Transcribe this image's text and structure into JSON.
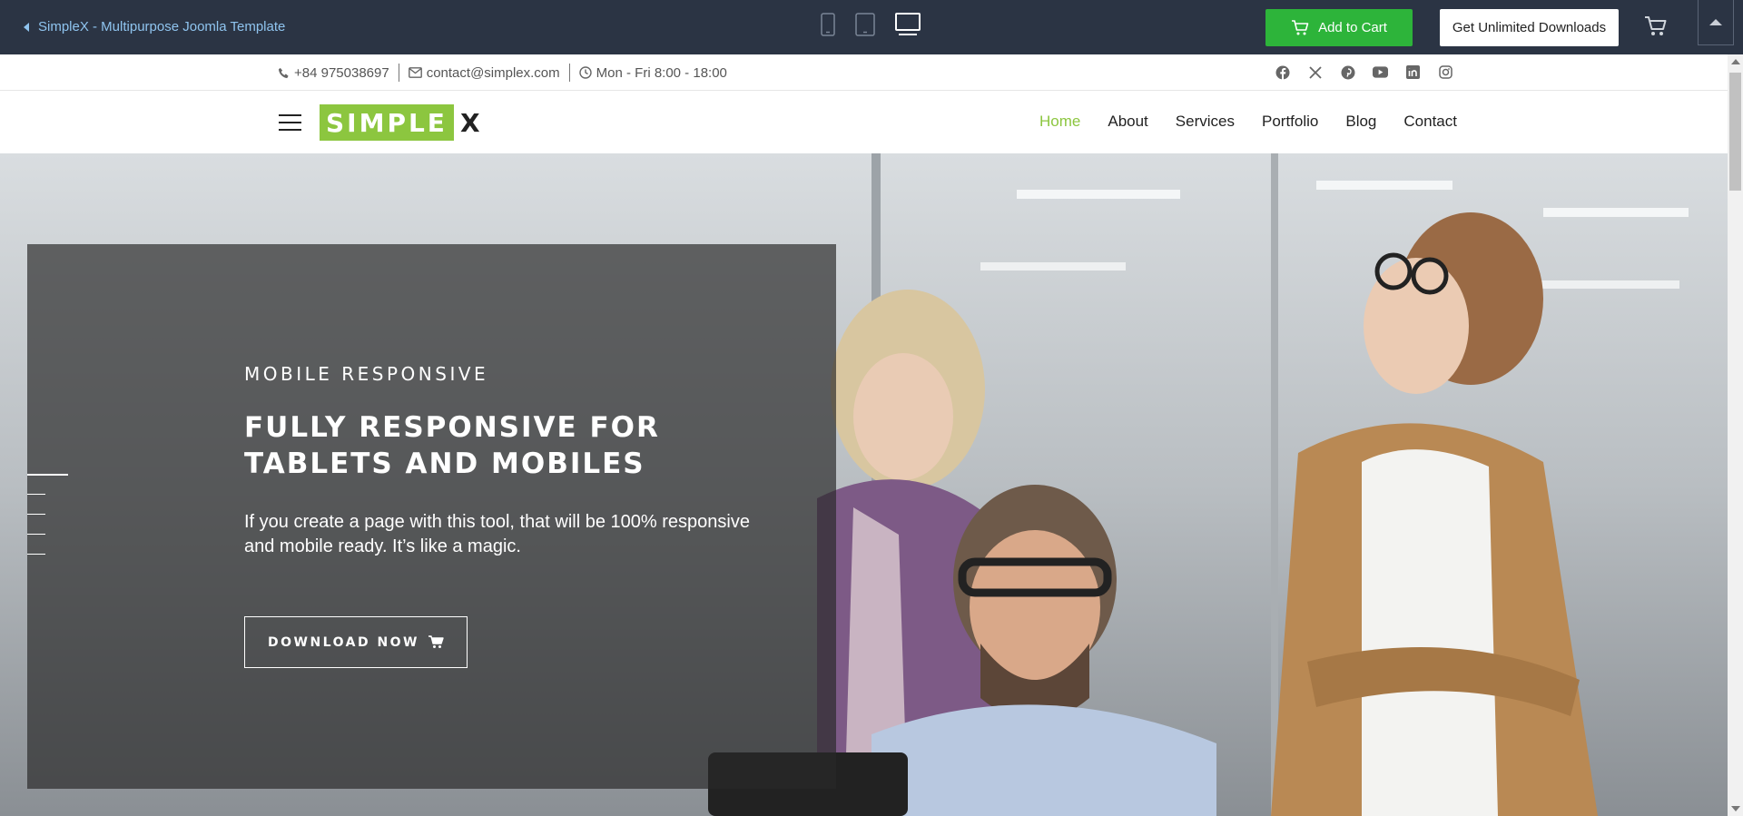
{
  "preview_bar": {
    "back_label": "SimpleX - Multipurpose Joomla Template",
    "devices": [
      "mobile-icon",
      "tablet-icon",
      "desktop-icon"
    ],
    "active_device": "desktop",
    "add_to_cart_label": "Add to Cart",
    "unlimited_label": "Get Unlimited Downloads",
    "colors": {
      "background": "#2b3444",
      "cart_button": "#2db43a",
      "link": "#8fc4ef"
    }
  },
  "info_bar": {
    "phone": "+84 975038697",
    "email": "contact@simplex.com",
    "hours": "Mon - Fri 8:00 - 18:00",
    "socials": [
      "facebook-icon",
      "x-twitter-icon",
      "pinterest-icon",
      "youtube-icon",
      "linkedin-icon",
      "instagram-icon"
    ]
  },
  "header": {
    "logo_box": "SIMPLE",
    "logo_x": "X",
    "nav": [
      {
        "label": "Home",
        "active": true
      },
      {
        "label": "About",
        "active": false
      },
      {
        "label": "Services",
        "active": false
      },
      {
        "label": "Portfolio",
        "active": false
      },
      {
        "label": "Blog",
        "active": false
      },
      {
        "label": "Contact",
        "active": false
      }
    ],
    "accent": "#8cc63f"
  },
  "hero": {
    "eyebrow": "MOBILE RESPONSIVE",
    "title": "FULLY RESPONSIVE FOR TABLETS AND MOBILES",
    "description": "If you create a page with this tool, that will be 100% responsive and mobile ready. It’s like a magic.",
    "button_label": "DOWNLOAD NOW",
    "slides_count": 5,
    "active_slide": 1
  }
}
